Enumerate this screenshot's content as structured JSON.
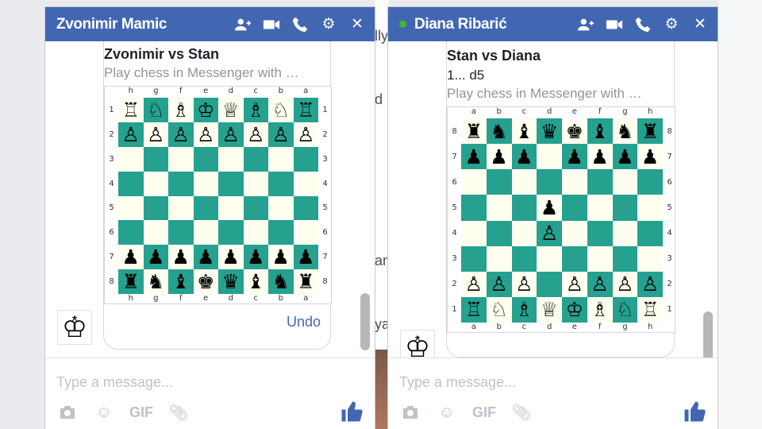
{
  "background": {
    "fragments": [
      "lly",
      "d",
      "an",
      "ya"
    ]
  },
  "left_chat": {
    "title": "Zvonimir Mamic",
    "card_title": "Zvonimir vs Stan",
    "card_subtitle": "Play chess in Messenger with …",
    "undo_label": "Undo",
    "files": [
      "h",
      "g",
      "f",
      "e",
      "d",
      "c",
      "b",
      "a"
    ],
    "ranks": [
      "1",
      "2",
      "3",
      "4",
      "5",
      "6",
      "7",
      "8"
    ],
    "board": [
      [
        "♖",
        "♘",
        "♗",
        "♔",
        "♕",
        "♗",
        "♘",
        "♖"
      ],
      [
        "♙",
        "♙",
        "♙",
        "♙",
        "♙",
        "♙",
        "♙",
        "♙"
      ],
      [
        "",
        "",
        "",
        "",
        "",
        "",
        "",
        ""
      ],
      [
        "",
        "",
        "",
        "",
        "",
        "",
        "",
        ""
      ],
      [
        "",
        "",
        "",
        "",
        "",
        "",
        "",
        ""
      ],
      [
        "",
        "",
        "",
        "",
        "",
        "",
        "",
        ""
      ],
      [
        "♟",
        "♟",
        "♟",
        "♟",
        "♟",
        "♟",
        "♟",
        "♟"
      ],
      [
        "♜",
        "♞",
        "♝",
        "♚",
        "♛",
        "♝",
        "♞",
        "♜"
      ]
    ],
    "avatar": "♔",
    "composer_placeholder": "Type a message...",
    "gif_label": "GIF"
  },
  "right_chat": {
    "title": "Diana Ribarić",
    "card_title": "Stan vs Diana",
    "card_move": "1... d5",
    "card_subtitle": "Play chess in Messenger with …",
    "files": [
      "a",
      "b",
      "c",
      "d",
      "e",
      "f",
      "g",
      "h"
    ],
    "ranks": [
      "8",
      "7",
      "6",
      "5",
      "4",
      "3",
      "2",
      "1"
    ],
    "board": [
      [
        "♜",
        "♞",
        "♝",
        "♛",
        "♚",
        "♝",
        "♞",
        "♜"
      ],
      [
        "♟",
        "♟",
        "♟",
        "",
        "♟",
        "♟",
        "♟",
        "♟"
      ],
      [
        "",
        "",
        "",
        "",
        "",
        "",
        "",
        ""
      ],
      [
        "",
        "",
        "",
        "♟",
        "",
        "",
        "",
        ""
      ],
      [
        "",
        "",
        "",
        "♙",
        "",
        "",
        "",
        ""
      ],
      [
        "",
        "",
        "",
        "",
        "",
        "",
        "",
        ""
      ],
      [
        "♙",
        "♙",
        "♙",
        "",
        "♙",
        "♙",
        "♙",
        "♙"
      ],
      [
        "♖",
        "♘",
        "♗",
        "♕",
        "♔",
        "♗",
        "♘",
        "♖"
      ]
    ],
    "avatar": "♔",
    "composer_placeholder": "Type a message...",
    "gif_label": "GIF"
  },
  "colors": {
    "header_blue": "#4267b2",
    "board_dark": "#26a08f",
    "board_light": "#fffff0",
    "online_dot": "#42b72a"
  }
}
